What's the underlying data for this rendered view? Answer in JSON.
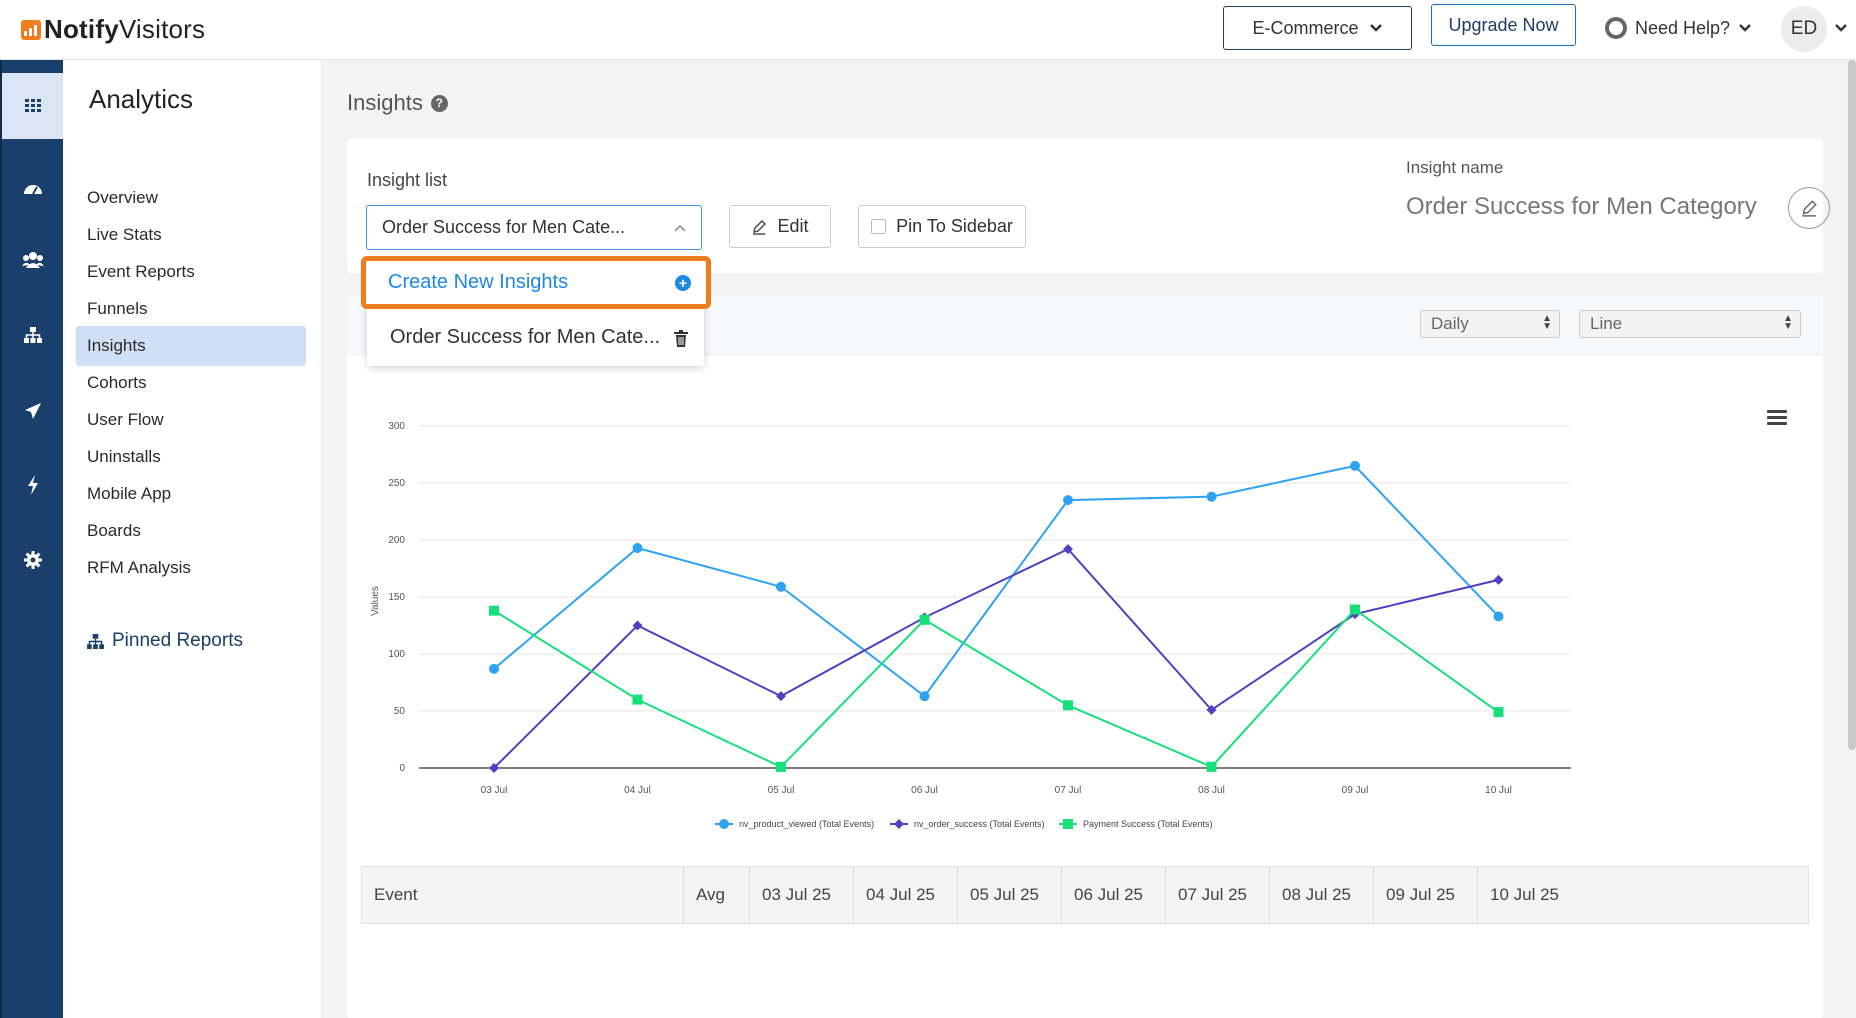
{
  "topbar": {
    "logo_bold": "Notify",
    "logo_light": "Visitors",
    "workspace": "E-Commerce",
    "upgrade": "Upgrade Now",
    "help": "Need Help?",
    "avatar": "ED"
  },
  "rail": {
    "icons": [
      "grid-icon",
      "dashboard-icon",
      "users-icon",
      "sitemap-icon",
      "send-icon",
      "bolt-icon",
      "gear-icon"
    ]
  },
  "nav": {
    "title": "Analytics",
    "items": [
      "Overview",
      "Live Stats",
      "Event Reports",
      "Funnels",
      "Insights",
      "Cohorts",
      "User Flow",
      "Uninstalls",
      "Mobile App",
      "Boards",
      "RFM Analysis"
    ],
    "pinned": "Pinned Reports"
  },
  "page": {
    "title": "Insights",
    "insight_list_label": "Insight list",
    "selected_insight": "Order Success for Men Cate...",
    "edit": "Edit",
    "pin": "Pin To Sidebar",
    "insight_name_label": "Insight name",
    "insight_name": "Order Success for Men Category"
  },
  "dropdown": {
    "create": "Create New Insights",
    "items": [
      "Order Success for Men Cate..."
    ]
  },
  "controls": {
    "interval": "Daily",
    "chart_type": "Line"
  },
  "chart_data": {
    "type": "line",
    "x": [
      "03 Jul",
      "04 Jul",
      "05 Jul",
      "06 Jul",
      "07 Jul",
      "08 Jul",
      "09 Jul",
      "10 Jul"
    ],
    "ylabel": "Values",
    "ylim": [
      0,
      300
    ],
    "yticks": [
      0,
      50,
      100,
      150,
      200,
      250,
      300
    ],
    "series": [
      {
        "name": "nv_product_viewed (Total Events)",
        "color": "#2ea3f2",
        "marker": "circle",
        "values": [
          87,
          193,
          159,
          63,
          235,
          238,
          265,
          133
        ]
      },
      {
        "name": "nv_order_success (Total Events)",
        "color": "#5040c0",
        "marker": "diamond",
        "values": [
          0,
          125,
          63,
          132,
          192,
          51,
          135,
          165
        ]
      },
      {
        "name": "Payment Success (Total Events)",
        "color": "#16e07a",
        "marker": "square",
        "values": [
          138,
          60,
          1,
          130,
          55,
          1,
          139,
          49
        ]
      }
    ],
    "legend": "bottom-center",
    "grid": true
  },
  "table": {
    "headers": [
      "Event",
      "Avg",
      "03 Jul 25",
      "04 Jul 25",
      "05 Jul 25",
      "06 Jul 25",
      "07 Jul 25",
      "08 Jul 25",
      "09 Jul 25",
      "10 Jul 25"
    ]
  }
}
